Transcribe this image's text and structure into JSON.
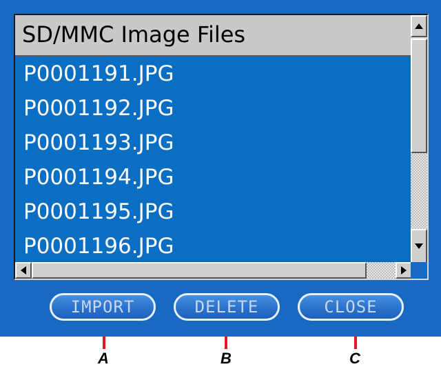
{
  "window": {
    "title": "SD/MMC Image Files"
  },
  "files": [
    "P0001191.JPG",
    "P0001192.JPG",
    "P0001193.JPG",
    "P0001194.JPG",
    "P0001195.JPG",
    "P0001196.JPG"
  ],
  "buttons": {
    "import": "IMPORT",
    "delete": "DELETE",
    "close": "CLOSE"
  },
  "callouts": {
    "a": "A",
    "b": "B",
    "c": "C"
  },
  "colors": {
    "dialog_bg": "#1769c1",
    "list_selection": "#0a6fc3",
    "callout_line": "#e4151c"
  }
}
